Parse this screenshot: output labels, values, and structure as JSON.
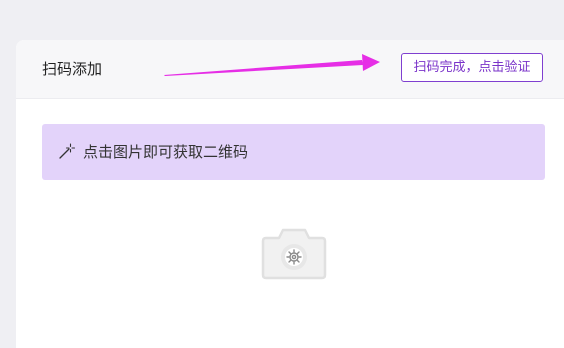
{
  "header": {
    "title": "扫码添加",
    "verify_button": "扫码完成，点击验证"
  },
  "hint": {
    "icon": "magic-wand-icon",
    "text": "点击图片即可获取二维码"
  },
  "qr_placeholder": {
    "icon": "camera-icon"
  },
  "colors": {
    "accent": "#7a33c9",
    "hint_background": "#e3d3fa",
    "arrow": "#e62ee6"
  }
}
